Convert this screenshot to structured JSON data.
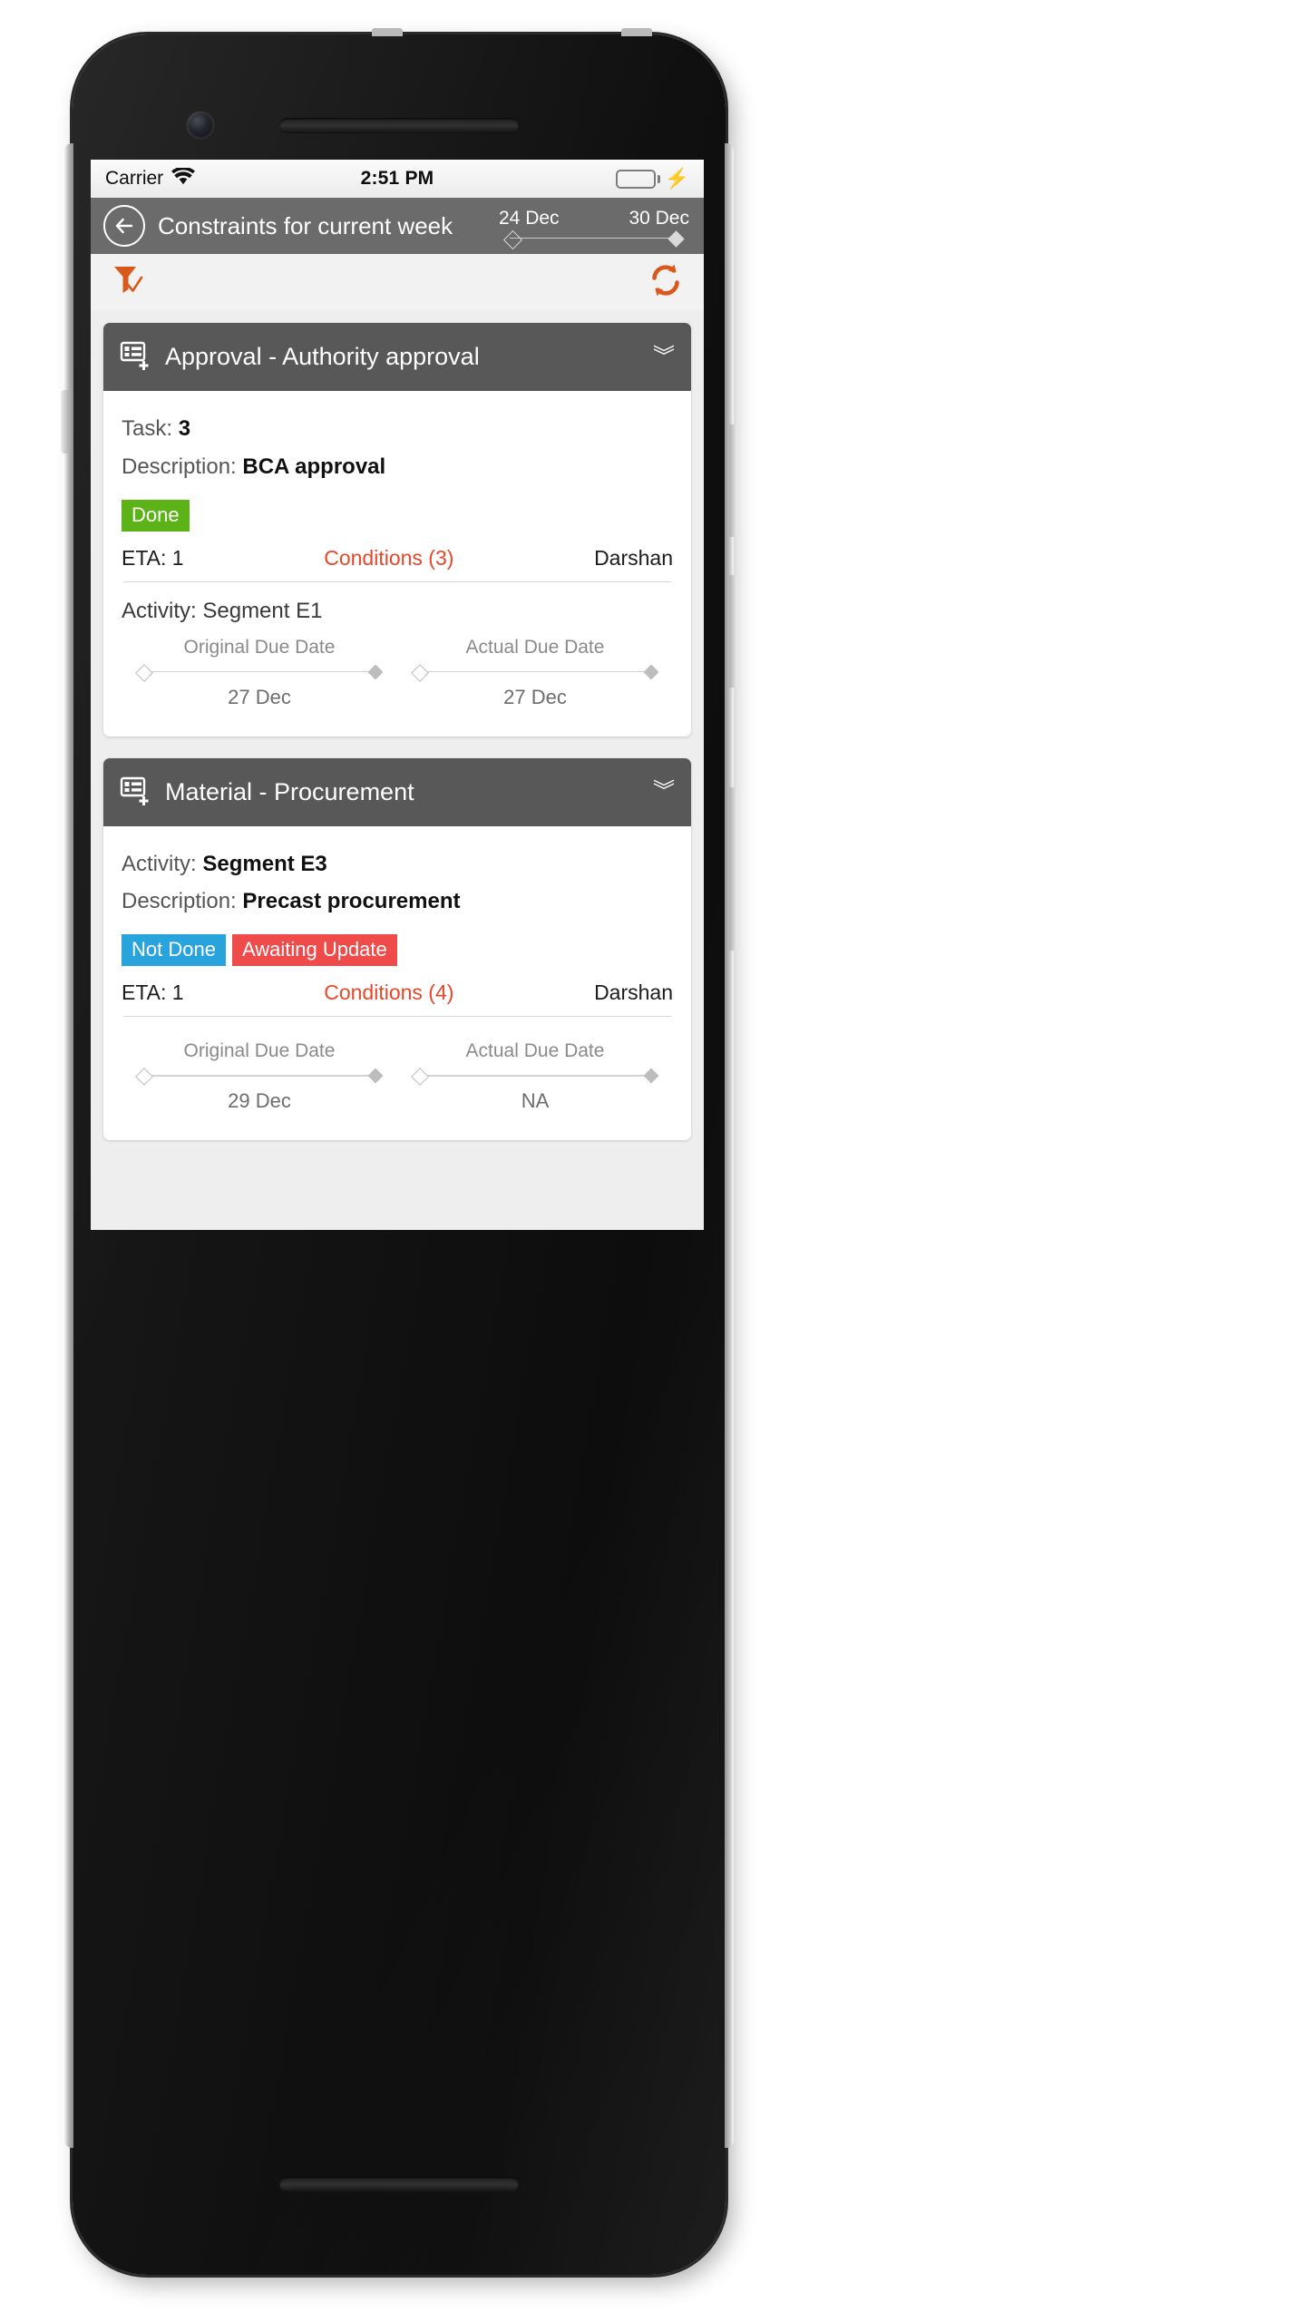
{
  "status_bar": {
    "carrier": "Carrier",
    "wifi_icon": "wifi-icon",
    "time": "2:51 PM",
    "battery_icon": "battery-full-icon",
    "charging_icon": "lightning-bolt-icon"
  },
  "nav_bar": {
    "back_icon": "back-arrow-icon",
    "title": "Constraints for current week",
    "range_start": "24 Dec",
    "range_end": "30 Dec"
  },
  "toolbar": {
    "filter_icon": "filter-check-icon",
    "refresh_icon": "refresh-icon"
  },
  "colors": {
    "accent_orange": "#d9581a",
    "conditions_red": "#e8472a",
    "done_green": "#5cb318",
    "not_done_blue": "#29a3dc",
    "awaiting_red": "#ef4b4b",
    "card_header_gray": "#585858",
    "nav_gray": "#6b6b6b"
  },
  "cards": [
    {
      "icon": "form-add-icon",
      "title": "Approval - Authority approval",
      "chevron_icon": "chevron-down-icon",
      "fields": [
        {
          "label": "Task:",
          "value": "3"
        },
        {
          "label": "Description:",
          "value": "BCA approval"
        }
      ],
      "badges": [
        {
          "text": "Done",
          "color": "#5cb318"
        }
      ],
      "eta": "ETA: 1",
      "conditions": "Conditions (3)",
      "owner": "Darshan",
      "activity_label": "Activity:",
      "activity_value": "Segment E1",
      "due_dates": [
        {
          "title": "Original Due Date",
          "date": "27 Dec"
        },
        {
          "title": "Actual Due Date",
          "date": "27 Dec"
        }
      ]
    },
    {
      "icon": "form-add-icon",
      "title": "Material - Procurement",
      "chevron_icon": "chevron-down-icon",
      "fields": [
        {
          "label": "Activity:",
          "value": "Segment E3"
        },
        {
          "label": "Description:",
          "value": "Precast procurement"
        }
      ],
      "badges": [
        {
          "text": "Not Done",
          "color": "#29a3dc"
        },
        {
          "text": "Awaiting Update",
          "color": "#ef4b4b"
        }
      ],
      "eta": "ETA: 1",
      "conditions": "Conditions (4)",
      "owner": "Darshan",
      "activity_label": "",
      "activity_value": "",
      "due_dates": [
        {
          "title": "Original Due Date",
          "date": "29 Dec"
        },
        {
          "title": "Actual Due Date",
          "date": "NA"
        }
      ]
    }
  ]
}
